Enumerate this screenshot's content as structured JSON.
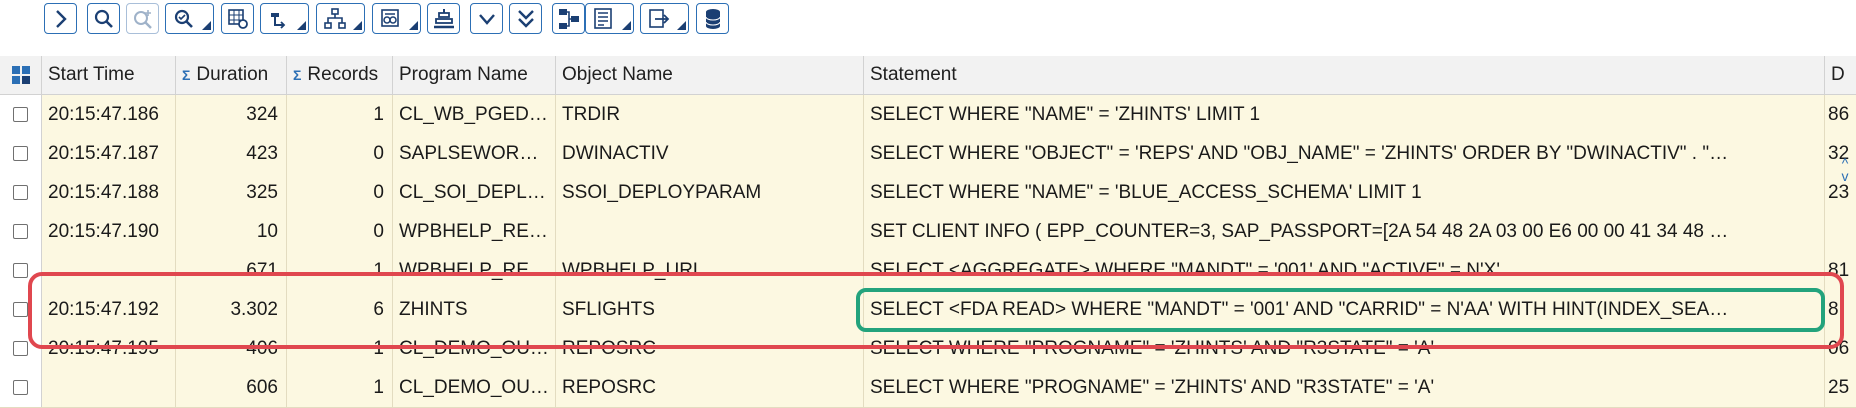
{
  "toolbar": {
    "buttons": [
      {
        "name": "expand-button",
        "icon": "chevron-right-icon",
        "dropdown": false
      },
      {
        "name": "find-button",
        "icon": "magnifier-icon",
        "dropdown": false
      },
      {
        "name": "find-next-button",
        "icon": "magnifier-plus-icon",
        "dropdown": false
      },
      {
        "name": "filter-button",
        "icon": "magnifier-check-icon",
        "dropdown": true
      },
      {
        "name": "settings-button",
        "icon": "grid-gear-icon",
        "dropdown": false
      },
      {
        "name": "sort-button",
        "icon": "sort-icon",
        "dropdown": true
      },
      {
        "name": "hierarchy-button",
        "icon": "hierarchy-icon",
        "dropdown": true
      },
      {
        "name": "aggregate-button",
        "icon": "aggregate-icon",
        "dropdown": true
      },
      {
        "name": "align-button",
        "icon": "align-icon",
        "dropdown": false
      },
      {
        "name": "collapse-button",
        "icon": "chevron-down-icon",
        "dropdown": false
      },
      {
        "name": "collapse-all-button",
        "icon": "double-chevron-down-icon",
        "dropdown": false
      },
      {
        "name": "structure-button",
        "icon": "structure-icon",
        "dropdown": false
      },
      {
        "name": "layout-button",
        "icon": "layout-icon",
        "dropdown": true
      },
      {
        "name": "export-button",
        "icon": "export-icon",
        "dropdown": true
      },
      {
        "name": "database-button",
        "icon": "database-icon",
        "dropdown": false
      }
    ]
  },
  "grid": {
    "columns": [
      {
        "key": "start_time",
        "label": "Start Time",
        "sigma": false,
        "sorted": true
      },
      {
        "key": "duration",
        "label": "Duration",
        "sigma": true
      },
      {
        "key": "records",
        "label": "Records",
        "sigma": true
      },
      {
        "key": "program",
        "label": "Program Name",
        "sigma": false
      },
      {
        "key": "object",
        "label": "Object Name",
        "sigma": false
      },
      {
        "key": "statement",
        "label": "Statement",
        "sigma": false
      },
      {
        "key": "d",
        "label": "D",
        "sigma": false
      }
    ],
    "rows": [
      {
        "start_time": "20:15:47.186",
        "duration": "324",
        "records": "1",
        "program": "CL_WB_PGED…",
        "object": "TRDIR",
        "statement": "SELECT  WHERE \"NAME\" = 'ZHINTS'  LIMIT 1",
        "d": "86"
      },
      {
        "start_time": "20:15:47.187",
        "duration": "423",
        "records": "0",
        "program": "SAPLSEWOR…",
        "object": "DWINACTIV",
        "statement": "SELECT  WHERE \"OBJECT\" = 'REPS' AND \"OBJ_NAME\" = 'ZHINTS'  ORDER BY \"DWINACTIV\" . \"…",
        "d": "32"
      },
      {
        "start_time": "20:15:47.188",
        "duration": "325",
        "records": "0",
        "program": "CL_SOI_DEPL…",
        "object": "SSOI_DEPLOYPARAM",
        "statement": "SELECT  WHERE \"NAME\" = 'BLUE_ACCESS_SCHEMA'  LIMIT 1",
        "d": "23"
      },
      {
        "start_time": "20:15:47.190",
        "duration": "10",
        "records": "0",
        "program": "WPBHELP_RE…",
        "object": "",
        "statement": "SET CLIENT INFO ( EPP_COUNTER=3, SAP_PASSPORT=[2A 54 48 2A 03 00 E6 00 00 41 34 48 …",
        "d": ""
      },
      {
        "start_time": "",
        "duration": "671",
        "records": "1",
        "program": "WPBHELP_RE…",
        "object": "WPBHELP_URL",
        "statement": "SELECT <AGGREGATE>  WHERE \"MANDT\" = '001'  AND \"ACTIVE\" = N'X'",
        "d": "81"
      },
      {
        "start_time": "20:15:47.192",
        "duration": "3.302",
        "records": "6",
        "program": "ZHINTS",
        "object": "SFLIGHTS",
        "statement": "SELECT <FDA READ>  WHERE \"MANDT\" = '001'  AND \"CARRID\" = N'AA'  WITH HINT(INDEX_SEA…",
        "d": "8"
      },
      {
        "start_time": "20:15:47.195",
        "duration": "406",
        "records": "1",
        "program": "CL_DEMO_OU…",
        "object": "REPOSRC",
        "statement": "SELECT  WHERE \"PROGNAME\" = 'ZHINTS' AND \"R3STATE\" = 'A'",
        "d": "06"
      },
      {
        "start_time": "",
        "duration": "606",
        "records": "1",
        "program": "CL_DEMO_OU…",
        "object": "REPOSRC",
        "statement": "SELECT  WHERE \"PROGNAME\" = 'ZHINTS' AND \"R3STATE\" = 'A'",
        "d": "25"
      }
    ]
  },
  "colors": {
    "highlight_row": "#e0474f",
    "highlight_statement": "#23a37c",
    "row_background": "#fcf8e1",
    "accent": "#2c6fb5"
  }
}
